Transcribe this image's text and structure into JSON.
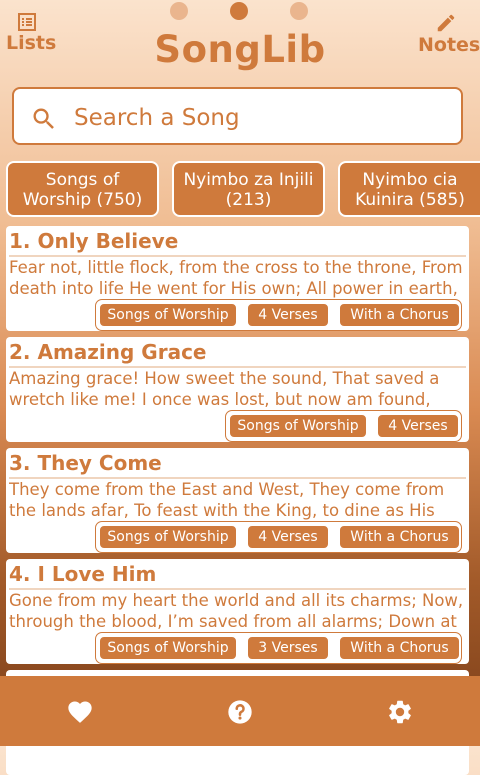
{
  "header": {
    "lists_label": "Lists",
    "notes_label": "Notes",
    "app_title": "SongLib"
  },
  "search": {
    "placeholder": "Search a Song"
  },
  "books": [
    {
      "line1": "Songs of",
      "line2": "Worship (750)"
    },
    {
      "line1": "Nyimbo za Injili",
      "line2": "(213)"
    },
    {
      "line1": "Nyimbo cia",
      "line2": "Kuinira  (585)"
    }
  ],
  "songs": [
    {
      "title": "1. Only Believe",
      "text": "Fear not, little flock, from the cross to the throne, From death into life He went for His own; All power in earth,",
      "tags": [
        "Songs of Worship",
        "4 Verses",
        "With a Chorus"
      ]
    },
    {
      "title": "2. Amazing Grace",
      "text": "Amazing grace! How sweet the sound, That saved a wretch like me! I once was lost, but now am found, Was",
      "tags": [
        "Songs of Worship",
        "4 Verses"
      ]
    },
    {
      "title": "3. They Come",
      "text": "They come from the East and West, They come from the lands afar, To feast with the King, to dine as His guest",
      "tags": [
        "Songs of Worship",
        "4 Verses",
        "With a Chorus"
      ]
    },
    {
      "title": "4. I Love Him",
      "text": "Gone from my heart the world and all its charms; Now, through the blood, I’m saved from all alarms; Down at",
      "tags": [
        "Songs of Worship",
        "3 Verses",
        "With a Chorus"
      ]
    }
  ],
  "icons": {
    "lists": "list-icon",
    "notes": "pencil-icon",
    "search": "search-icon",
    "likes": "heart-icon",
    "help": "help-icon",
    "settings": "gear-icon"
  },
  "colors": {
    "accent": "#cf7a3c",
    "card": "#ffffff"
  }
}
